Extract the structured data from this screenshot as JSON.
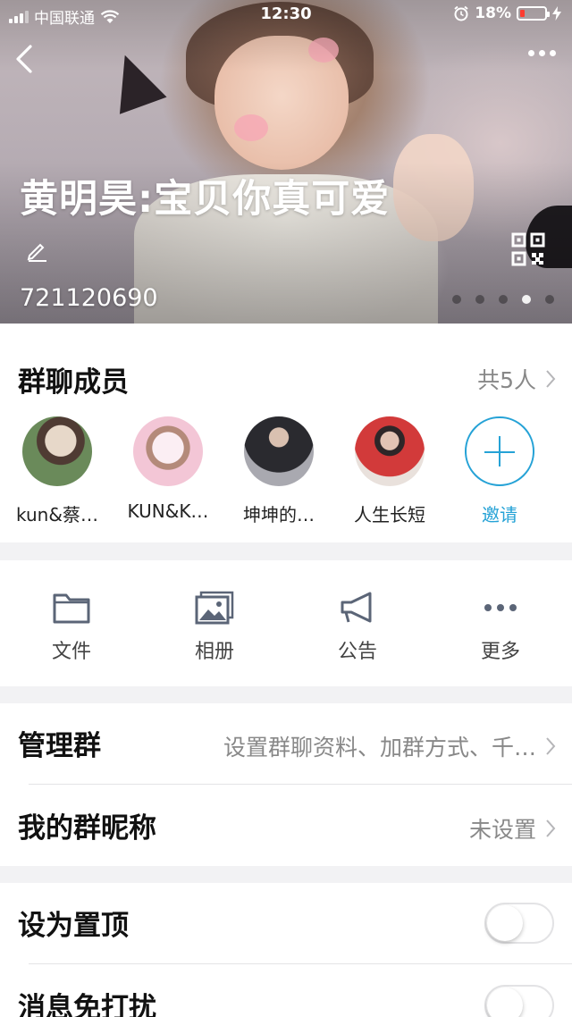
{
  "status_bar": {
    "carrier": "中国联通",
    "time": "12:30",
    "battery": "18%",
    "battery_level": 0.18
  },
  "header": {
    "title": "黄明昊:宝贝你真可爱",
    "group_id": "721120690",
    "carousel_total": 5,
    "carousel_active": 4
  },
  "members": {
    "heading": "群聊成员",
    "count_label": "共5人",
    "items": [
      {
        "name": "kun&蔡…",
        "avatar_colors": [
          "#6a8a5a",
          "#e7d8c9"
        ]
      },
      {
        "name": "KUN&K…",
        "avatar_colors": [
          "#f3c6d6",
          "#fbeef3"
        ]
      },
      {
        "name": "坤坤的…",
        "avatar_colors": [
          "#3a3a40",
          "#a9a9b0"
        ]
      },
      {
        "name": "人生长短",
        "avatar_colors": [
          "#d23a3a",
          "#e9e1dc"
        ]
      }
    ],
    "invite_label": "邀请"
  },
  "tools": [
    {
      "label": "文件",
      "icon": "folder-icon"
    },
    {
      "label": "相册",
      "icon": "album-icon"
    },
    {
      "label": "公告",
      "icon": "megaphone-icon"
    },
    {
      "label": "更多",
      "icon": "more-icon"
    }
  ],
  "settings": {
    "manage": {
      "label": "管理群",
      "value": "设置群聊资料、加群方式、千…"
    },
    "nickname": {
      "label": "我的群昵称",
      "value": "未设置"
    },
    "pin_top": {
      "label": "设为置顶",
      "on": false
    },
    "mute": {
      "label": "消息免打扰",
      "on": false
    }
  },
  "colors": {
    "accent": "#25a2d6",
    "battery_low": "#ff3b30",
    "secondary_text": "#888888"
  }
}
